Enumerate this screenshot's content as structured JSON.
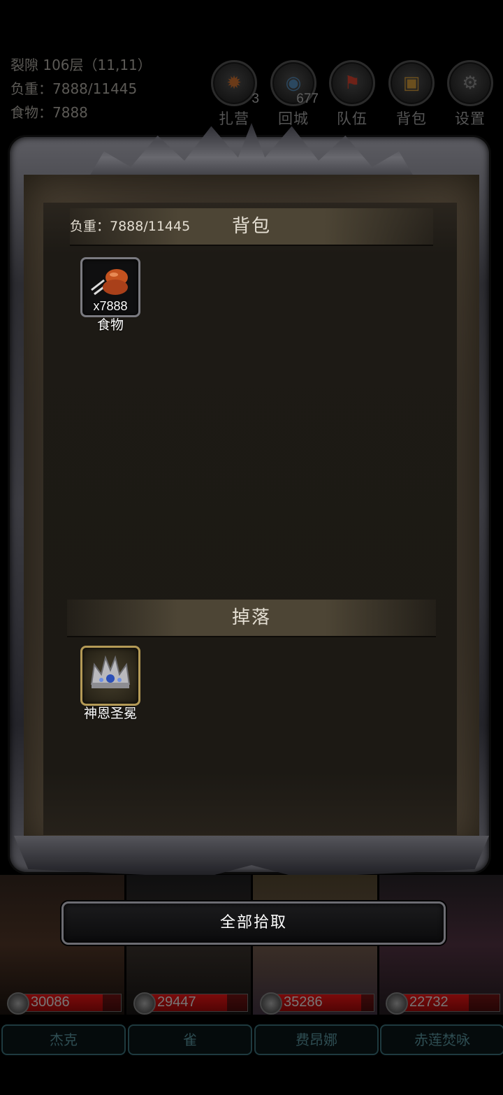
{
  "hud": {
    "location": "裂隙 106层（11,11）",
    "weight_line": "负重：7888/11445",
    "food_line": "食物：7888"
  },
  "hud_buttons": [
    {
      "label": "扎营",
      "badge": "3",
      "icon": "campfire-icon"
    },
    {
      "label": "回城",
      "badge": "677",
      "icon": "portal-icon"
    },
    {
      "label": "队伍",
      "badge": "",
      "icon": "banner-icon"
    },
    {
      "label": "背包",
      "badge": "",
      "icon": "backpack-icon"
    },
    {
      "label": "设置",
      "badge": "",
      "icon": "gear-icon"
    }
  ],
  "backpack": {
    "weight": "负重：7888/11445",
    "title": "背包",
    "items": [
      {
        "name": "食物",
        "quantity": "x7888",
        "icon": "meat-icon"
      }
    ]
  },
  "drops": {
    "title": "掉落",
    "items": [
      {
        "name": "神恩圣冕",
        "icon": "crown-icon"
      }
    ]
  },
  "collect_all_label": "全部拾取",
  "party": [
    {
      "name": "杰克",
      "hp": "30086",
      "hp_fraction": 0.82
    },
    {
      "name": "雀",
      "hp": "29447",
      "hp_fraction": 0.8
    },
    {
      "name": "费昂娜",
      "hp": "35286",
      "hp_fraction": 0.88
    },
    {
      "name": "赤莲焚咏",
      "hp": "22732",
      "hp_fraction": 0.7
    }
  ]
}
